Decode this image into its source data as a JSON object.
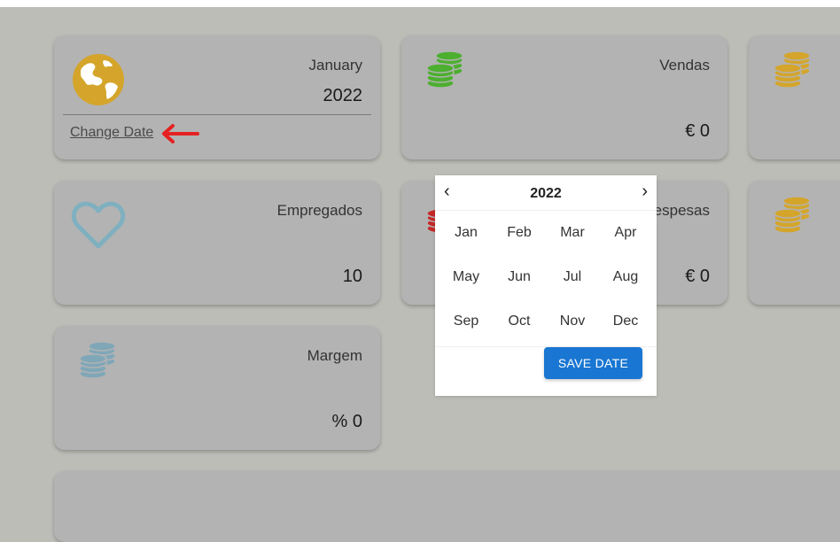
{
  "date_card": {
    "month": "January",
    "year": "2022",
    "change_label": "Change Date"
  },
  "cards": {
    "vendas": {
      "title": "Vendas",
      "value": "€ 0"
    },
    "empregados": {
      "title": "Empregados",
      "value": "10"
    },
    "despesas": {
      "title": "Despesas",
      "value": "€ 0"
    },
    "margem": {
      "title": "Margem",
      "value": "% 0"
    }
  },
  "picker": {
    "prev": "‹",
    "next": "›",
    "year": "2022",
    "months": [
      "Jan",
      "Feb",
      "Mar",
      "Apr",
      "May",
      "Jun",
      "Jul",
      "Aug",
      "Sep",
      "Oct",
      "Nov",
      "Dec"
    ],
    "save_label": "SAVE DATE"
  },
  "colors": {
    "globe": "#d4a52a",
    "coins_green": "#4caf2f",
    "coins_gold": "#d4a52a",
    "coins_red": "#c62828",
    "coins_blue": "#7fa7b8",
    "heart": "#7fb0c0",
    "arrow": "#e52121",
    "primary": "#1976d2"
  },
  "icons": [
    "globe-icon",
    "coins-icon",
    "heart-icon",
    "arrow-left-icon"
  ]
}
